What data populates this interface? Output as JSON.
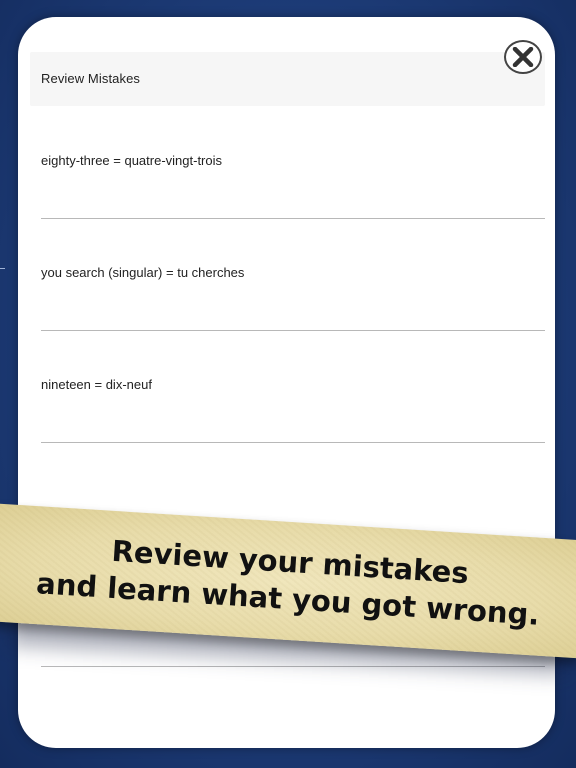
{
  "header": {
    "title": "Review Mistakes",
    "close_icon": "close-x-icon"
  },
  "mistakes": [
    {
      "text": "eighty-three = quatre-vingt-trois"
    },
    {
      "text": "you search (singular) = tu cherches"
    },
    {
      "text": "nineteen = dix-neuf"
    }
  ],
  "banner": {
    "line1": "Review your mistakes",
    "line2": "and learn what you got wrong."
  },
  "colors": {
    "background": "#1f3f7d",
    "banner": "#ebe0b0",
    "modal": "#ffffff"
  }
}
